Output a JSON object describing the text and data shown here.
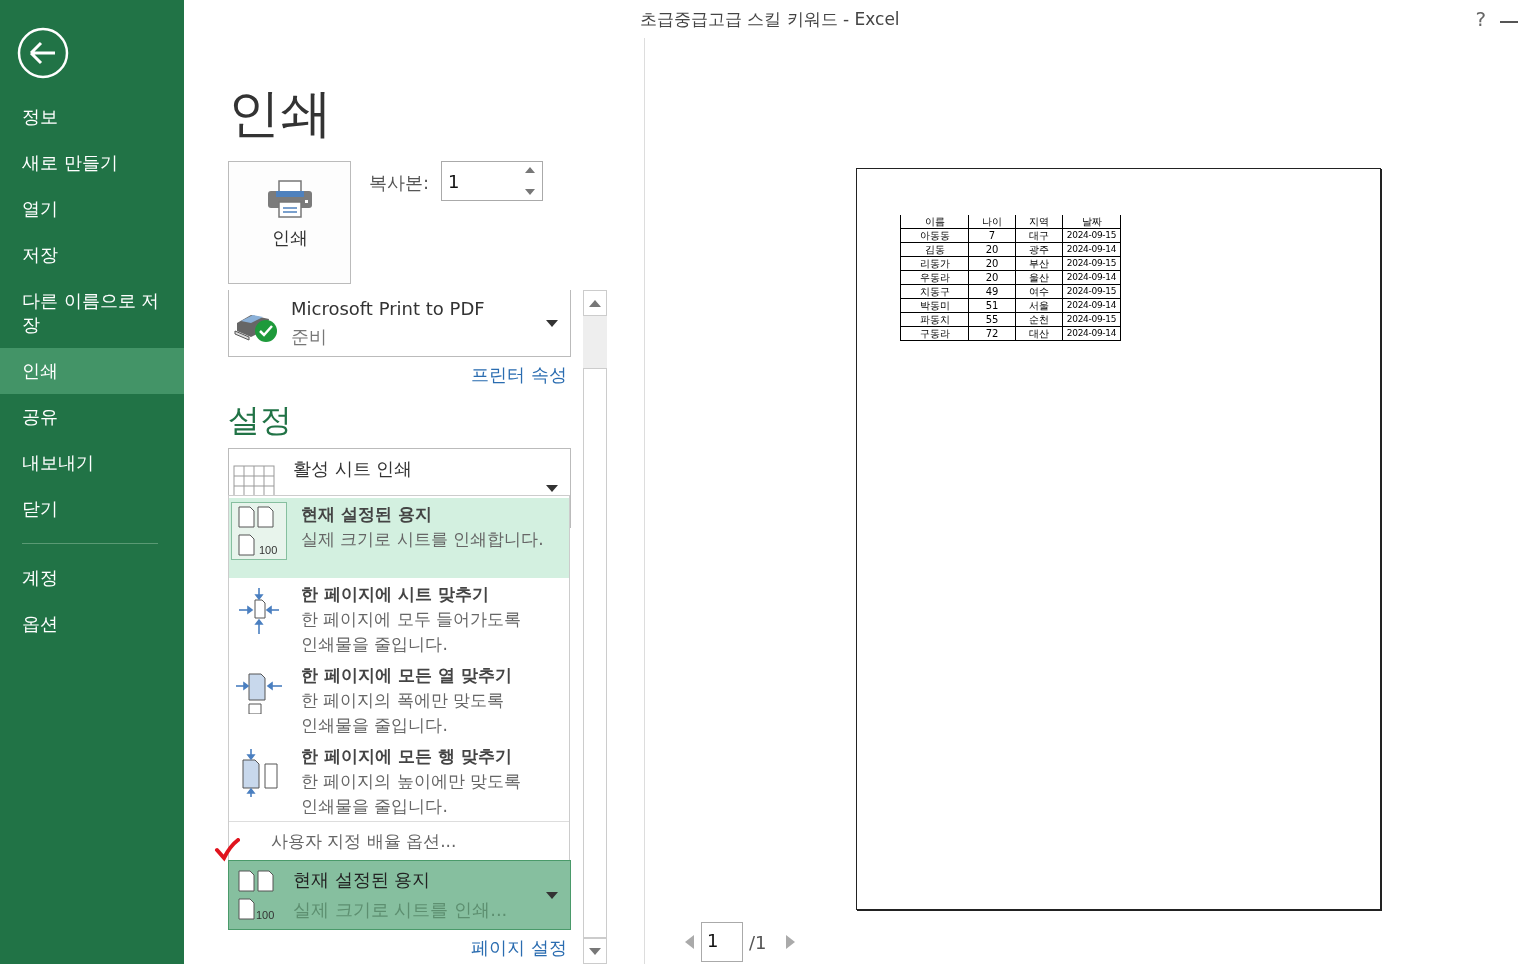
{
  "window": {
    "title": "초급중급고급 스킬 키워드 - Excel",
    "help": "?"
  },
  "sidebar": {
    "items": [
      {
        "label": "정보",
        "selected": false
      },
      {
        "label": "새로 만들기",
        "selected": false
      },
      {
        "label": "열기",
        "selected": false
      },
      {
        "label": "저장",
        "selected": false
      },
      {
        "label": "다른 이름으로 저장",
        "selected": false
      },
      {
        "label": "인쇄",
        "selected": true
      },
      {
        "label": "공유",
        "selected": false
      },
      {
        "label": "내보내기",
        "selected": false
      },
      {
        "label": "닫기",
        "selected": false
      }
    ],
    "bottom_items": [
      {
        "label": "계정",
        "selected": false
      },
      {
        "label": "옵션",
        "selected": false
      }
    ]
  },
  "page_title": "인쇄",
  "print_button": {
    "label": "인쇄"
  },
  "copies": {
    "label": "복사본:",
    "value": "1"
  },
  "printer": {
    "name": "Microsoft Print to PDF",
    "status": "준비",
    "properties_link": "프린터 속성"
  },
  "settings": {
    "heading": "설정",
    "sheet_dropdown": {
      "title": "활성 시트 인쇄"
    },
    "scaling_menu": {
      "options": [
        {
          "kind": "actual",
          "title": "현재 설정된 용지",
          "description": [
            "실제 크기로 시트를 인쇄합니다."
          ],
          "badge": "100",
          "selected": true
        },
        {
          "kind": "fit_sheet",
          "title": "한 페이지에 시트 맞추기",
          "description": [
            "한 페이지에 모두 들어가도록",
            "인쇄물을 줄입니다."
          ],
          "selected": false
        },
        {
          "kind": "fit_columns",
          "title": "한 페이지에 모든 열 맞추기",
          "description": [
            "한 페이지의 폭에만 맞도록",
            "인쇄물을 줄입니다."
          ],
          "selected": false
        },
        {
          "kind": "fit_rows",
          "title": "한 페이지에 모든 행 맞추기",
          "description": [
            "한 페이지의 높이에만 맞도록",
            "인쇄물을 줄입니다."
          ],
          "selected": false
        }
      ],
      "custom_link": "사용자 지정 배율 옵션..."
    },
    "scaling_dropdown": {
      "title": "현재 설정된 용지",
      "description": "실제 크기로 시트를 인쇄...",
      "badge": "100"
    },
    "page_setup_link": "페이지 설정"
  },
  "preview": {
    "table": {
      "columns": [
        "이름",
        "나이",
        "지역",
        "날짜"
      ],
      "rows": [
        [
          "아동동",
          "7",
          "대구",
          "2024-09-15"
        ],
        [
          "김동",
          "20",
          "광주",
          "2024-09-14"
        ],
        [
          "리동가",
          "20",
          "부산",
          "2024-09-15"
        ],
        [
          "우동라",
          "20",
          "울산",
          "2024-09-14"
        ],
        [
          "치동구",
          "49",
          "여수",
          "2024-09-15"
        ],
        [
          "박동미",
          "51",
          "서울",
          "2024-09-14"
        ],
        [
          "파동치",
          "55",
          "순천",
          "2024-09-15"
        ],
        [
          "구동라",
          "72",
          "대산",
          "2024-09-14"
        ]
      ]
    }
  },
  "pager": {
    "current": "1",
    "total": "/1"
  }
}
